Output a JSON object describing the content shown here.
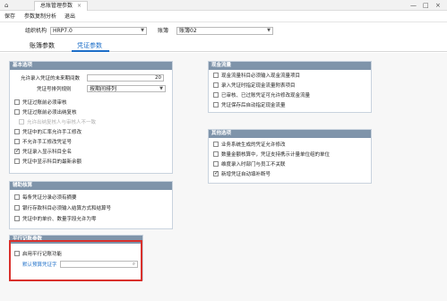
{
  "titlebar": {
    "tab_label": "总账管理参数",
    "close": "×",
    "minimize": "—",
    "maximize": "□",
    "win_close": "×"
  },
  "menu": {
    "save": "保存",
    "param_copy": "参数复制分析",
    "exit": "退出"
  },
  "filters": {
    "org_label": "组织机构",
    "org_value": "HRP7.0",
    "book_label": "账簿",
    "book_value": "账簿02"
  },
  "tabs": {
    "book_params": "账簿参数",
    "voucher_params": "凭证参数"
  },
  "basic": {
    "title": "基本选项",
    "future_label": "允许录入凭证的未来期间数",
    "future_value": "20",
    "numbering_label": "凭证号排列规则",
    "numbering_value": "按期间排列",
    "items": [
      {
        "label": "凭证过账前必须审核",
        "checked": false,
        "disabled": false
      },
      {
        "label": "凭证过账前必须出纳复核",
        "checked": false,
        "disabled": false
      },
      {
        "label": "允许出纳复核人与审核人不一致",
        "checked": false,
        "disabled": true
      },
      {
        "label": "凭证中的汇率允许手工修改",
        "checked": false,
        "disabled": false
      },
      {
        "label": "不允许手工修改凭证号",
        "checked": false,
        "disabled": false
      },
      {
        "label": "凭证录入显示科目全名",
        "checked": true,
        "disabled": false
      },
      {
        "label": "凭证中显示科目的最新余额",
        "checked": false,
        "disabled": false
      }
    ]
  },
  "cash_flow": {
    "title": "现金流量",
    "items": [
      {
        "label": "现金流量科目必须输入现金流量项目",
        "checked": false
      },
      {
        "label": "录入凭证时指定现金流量附表项目",
        "checked": false
      },
      {
        "label": "已审核、已过账凭证可允许修改现金流量",
        "checked": false
      },
      {
        "label": "凭证保存后自动指定现金流量",
        "checked": false
      }
    ]
  },
  "aux": {
    "title": "辅助核算",
    "items": [
      {
        "label": "每条凭证分录必须有摘要",
        "checked": false
      },
      {
        "label": "银行存款科目必须输入结算方式和结算号",
        "checked": false
      },
      {
        "label": "凭证中的单价、数量字段允许为零",
        "checked": false
      }
    ]
  },
  "other": {
    "title": "其他选项",
    "items": [
      {
        "label": "业务系统生成的凭证允许修改",
        "checked": false
      },
      {
        "label": "数量金额核算中，凭证支持携示计量单位组的单位",
        "checked": false
      },
      {
        "label": "维度录入时部门与员工不关联",
        "checked": false
      },
      {
        "label": "新增凭证自动填补断号",
        "checked": true
      }
    ]
  },
  "parallel": {
    "title": "平行记账参数",
    "enable_label": "启用平行记账功能",
    "enable_checked": false,
    "default_label": "默认预算凭证字",
    "default_value": ""
  },
  "colors": {
    "accent": "#1e6fc8",
    "group_header": "#7f94aa",
    "highlight": "#d9302c"
  }
}
